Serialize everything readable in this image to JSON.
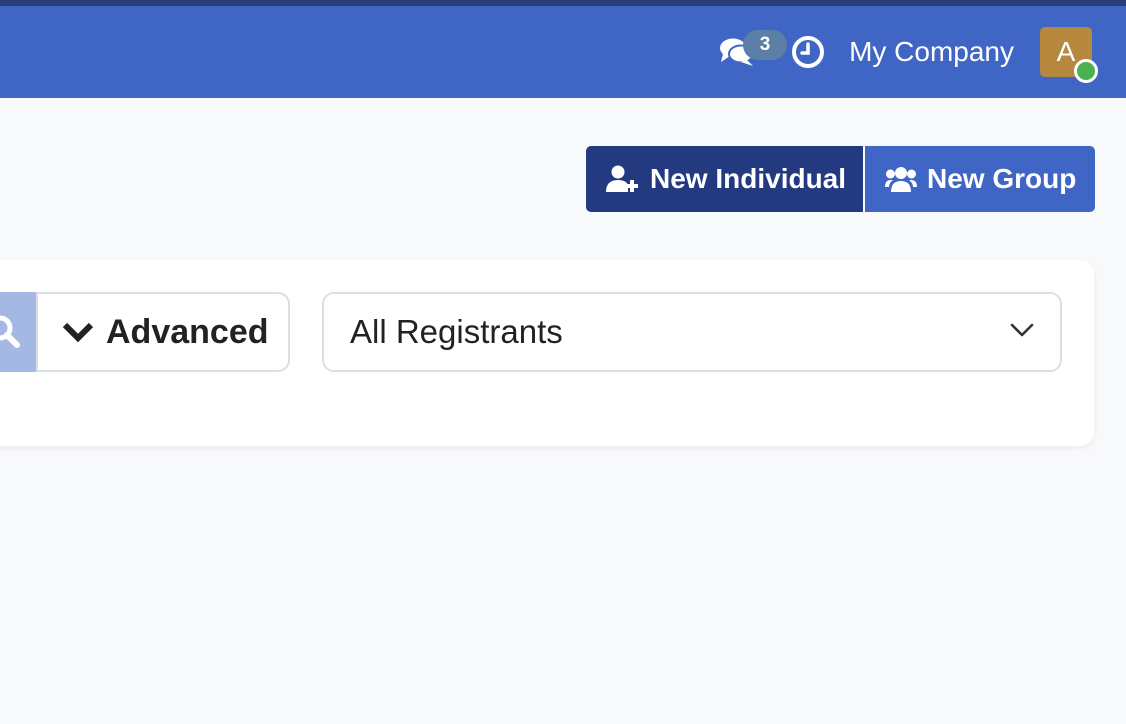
{
  "topbar": {
    "messages_badge": "3",
    "company_name": "My Company",
    "avatar_initial": "A",
    "icons": {
      "messages": "comments-icon",
      "activity": "clock-icon",
      "status": "online-status-dot"
    },
    "colors": {
      "bar": "#4066c5",
      "badge": "#5c7fa6",
      "avatar": "#b6893e",
      "online": "#4caf50"
    }
  },
  "actions": {
    "new_individual_label": "New Individual",
    "new_group_label": "New Group",
    "icons": {
      "individual": "user-plus-icon",
      "group": "users-icon"
    },
    "colors": {
      "individual": "#233a80",
      "group": "#3f66c5"
    }
  },
  "filters": {
    "advanced_label": "Advanced",
    "registrant_filter_value": "All Registrants",
    "icons": {
      "search": "search-icon",
      "advanced": "chevron-down-icon",
      "select": "chevron-down-icon"
    }
  }
}
